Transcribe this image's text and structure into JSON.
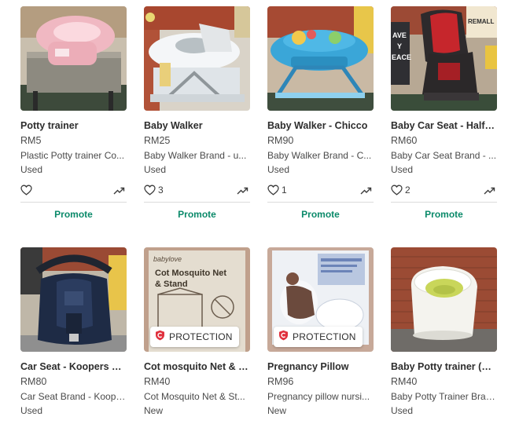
{
  "colors": {
    "promote": "#0b8a6a",
    "protection_icon": "#e0313e"
  },
  "listings": [
    {
      "title": "Potty trainer",
      "price": "RM5",
      "description": "Plastic Potty trainer Co...",
      "condition": "Used",
      "likes": "",
      "action": "Promote",
      "icons": [
        "heart-icon",
        "trending-icon"
      ]
    },
    {
      "title": "Baby Walker",
      "price": "RM25",
      "description": "Baby Walker Brand - u...",
      "condition": "Used",
      "likes": "3",
      "action": "Promote"
    },
    {
      "title": "Baby Walker - Chicco",
      "price": "RM90",
      "description": "Baby Walker Brand - C...",
      "condition": "Used",
      "likes": "1",
      "action": "Promote"
    },
    {
      "title": "Baby Car Seat - Halford",
      "price": "RM60",
      "description": "Baby Car Seat Brand - ...",
      "condition": "Used",
      "likes": "2",
      "action": "Promote"
    },
    {
      "title": "Car Seat - Koopers kal...",
      "price": "RM80",
      "description": "Car Seat Brand - Koope...",
      "condition": "Used"
    },
    {
      "title": "Cot mosquito Net & S...",
      "price": "RM40",
      "description": "Cot Mosquito Net & St...",
      "condition": "New",
      "badge": "PROTECTION",
      "image_text": {
        "brand": "babylove",
        "product": "Cot Mosquito Net",
        "product2": "& Stand"
      }
    },
    {
      "title": "Pregnancy Pillow",
      "price": "RM96",
      "description": "Pregnancy pillow nursi...",
      "condition": "New",
      "badge": "PROTECTION"
    },
    {
      "title": "Baby Potty trainer (M...",
      "price": "RM40",
      "description": "Baby Potty Trainer Bran...",
      "condition": "Used"
    }
  ],
  "image_text": {
    "store_sign": "REMALL",
    "wall_text_1": "AVE",
    "wall_text_2": "Y",
    "wall_text_3": "EACE"
  }
}
